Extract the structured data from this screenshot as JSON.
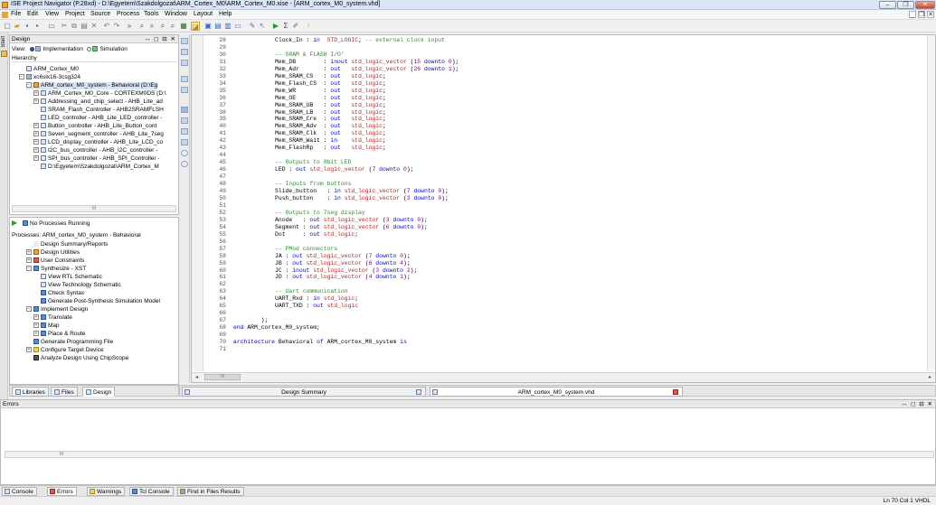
{
  "window": {
    "title": "ISE Project Navigator (P.28xd) - D:\\Egyetem\\Szakdolgozat\\ARM_Cortex_M0\\ARM_Cortex_M0.xise - [ARM_cortex_M0_system.vhd]",
    "min": "–",
    "max": "❐",
    "close": "✕"
  },
  "menu": [
    "File",
    "Edit",
    "View",
    "Project",
    "Source",
    "Process",
    "Tools",
    "Window",
    "Layout",
    "Help"
  ],
  "mdi": [
    "_",
    "❐",
    "✕"
  ],
  "left_strip": {
    "start": "Start"
  },
  "design": {
    "header": "Design",
    "controls": "↔ ◻ ⊟ ✕",
    "view_label": "View:",
    "impl": "Implementation",
    "sim": "Simulation",
    "hierarchy_label": "Hierarchy",
    "items": [
      "ARM_Cortex_M0",
      "xc6slx16-3csg324",
      "ARM_cortex_M0_system - Behavioral (D:\\Eg",
      "ARM_Cortex_M0_Core - CORTEXM0DS (D:\\",
      "Addressing_and_chip_select - AHB_Lite_ad",
      "SRAM_Flash_Controller - AHB2SRAMFLSH",
      "LED_controller - AHB_Lite_LED_controller -",
      "Button_controller - AHB_Lite_Button_cont",
      "Seven_segment_controller - AHB_Lite_7seg",
      "LCD_display_controller - AHB_Lite_LCD_co",
      "I2C_bus_controller - AHB_I2C_controller -",
      "SPI_bus_controller - AHB_SPI_Controller -",
      "D:\\Egyetem\\Szakdolgozat\\ARM_Cortex_M"
    ],
    "scroll_glyph": "III"
  },
  "processes": {
    "running": "No Processes Running",
    "label": "Processes: ARM_cortex_M0_system - Behavioral",
    "items": [
      "Design Summary/Reports",
      "Design Utilities",
      "User Constraints",
      "Synthesize - XST",
      "View RTL Schematic",
      "View Technology Schematic",
      "Check Syntax",
      "Generate Post-Synthesis Simulation Model",
      "Implement Design",
      "Translate",
      "Map",
      "Place & Route",
      "Generate Programming File",
      "Configure Target Device",
      "Analyze Design Using ChipScope"
    ]
  },
  "editor": {
    "line_numbers": [
      "28",
      "29",
      "30",
      "31",
      "32",
      "33",
      "34",
      "35",
      "36",
      "37",
      "38",
      "39",
      "40",
      "41",
      "42",
      "43",
      "44",
      "45",
      "46",
      "47",
      "48",
      "49",
      "50",
      "51",
      "52",
      "53",
      "54",
      "55",
      "56",
      "57",
      "58",
      "59",
      "60",
      "61",
      "62",
      "63",
      "64",
      "65",
      "66",
      "67",
      "68",
      "69",
      "70",
      "71"
    ],
    "lines": [
      "            Clock_In : in  STD_LOGIC; -- external clock input",
      "",
      "            -- SRAM & FLASH I/O'",
      "            Mem_DB        : inout std_logic_vector (15 downto 0);",
      "            Mem_Adr       : out   std_logic_vector (26 downto 1);",
      "            Mem_SRAM_CS   : out   std_logic;",
      "            Mem_Flash_CS  : out   std_logic;",
      "            Mem_WR        : out   std_logic;",
      "            Mem_OE        : out   std_logic;",
      "            Mem_SRAM_UB   : out   std_logic;",
      "            Mem_SRAM_LB   : out   std_logic;",
      "            Mem_SRAM_Cre  : out   std_logic;",
      "            Mem_SRAM_Adv  : out   std_logic;",
      "            Mem_SRAM_Clk  : out   std_logic;",
      "            Mem_SRAM_Wait : in    std_logic;",
      "            Mem_FlashRp   : out   std_logic;",
      "",
      "            -- Outputs to 8bit LED",
      "            LED : out std_logic_vector (7 downto 0);",
      "",
      "            -- Inputs from buttons",
      "            Slide_button   : in std_logic_vector (7 downto 0);",
      "            Push_button    : in std_logic_vector (3 downto 0);",
      "",
      "            -- Outputs to 7seg display",
      "            Anode   : out std_logic_vector (3 downto 0);",
      "            Segment : out std_logic_vector (6 downto 0);",
      "            Dot     : out std_logic;",
      "",
      "            -- PMod connectors",
      "            JA : out std_logic_vector (7 downto 0);",
      "            JB : out std_logic_vector (6 downto 4);",
      "            JC : inout std_logic_vector (3 downto 2);",
      "            JD : out std_logic_vector (4 downto 1);",
      "",
      "            -- Uart communication",
      "            UART_Rxd : in std_logic;",
      "            UART_TXD : out std_logic",
      "",
      "        );",
      "end ARM_cortex_M0_system;",
      "",
      "architecture Behavioral of ARM_cortex_M0_system is",
      ""
    ],
    "hscroll_glyph": "III"
  },
  "left_tabs": [
    "Libraries",
    "Files",
    "Design"
  ],
  "editor_tabs": {
    "design_summary": "Design Summary",
    "file": "ARM_cortex_M0_system.vhd"
  },
  "errors": {
    "header": "Errors",
    "controls": "↔ ◻ ⊟ ✕",
    "hscroll_glyph": "III"
  },
  "bottom_tabs": [
    "Console",
    "Errors",
    "Warnings",
    "Tcl Console",
    "Find in Files Results"
  ],
  "status": "Ln 70 Col 1   VHDL"
}
